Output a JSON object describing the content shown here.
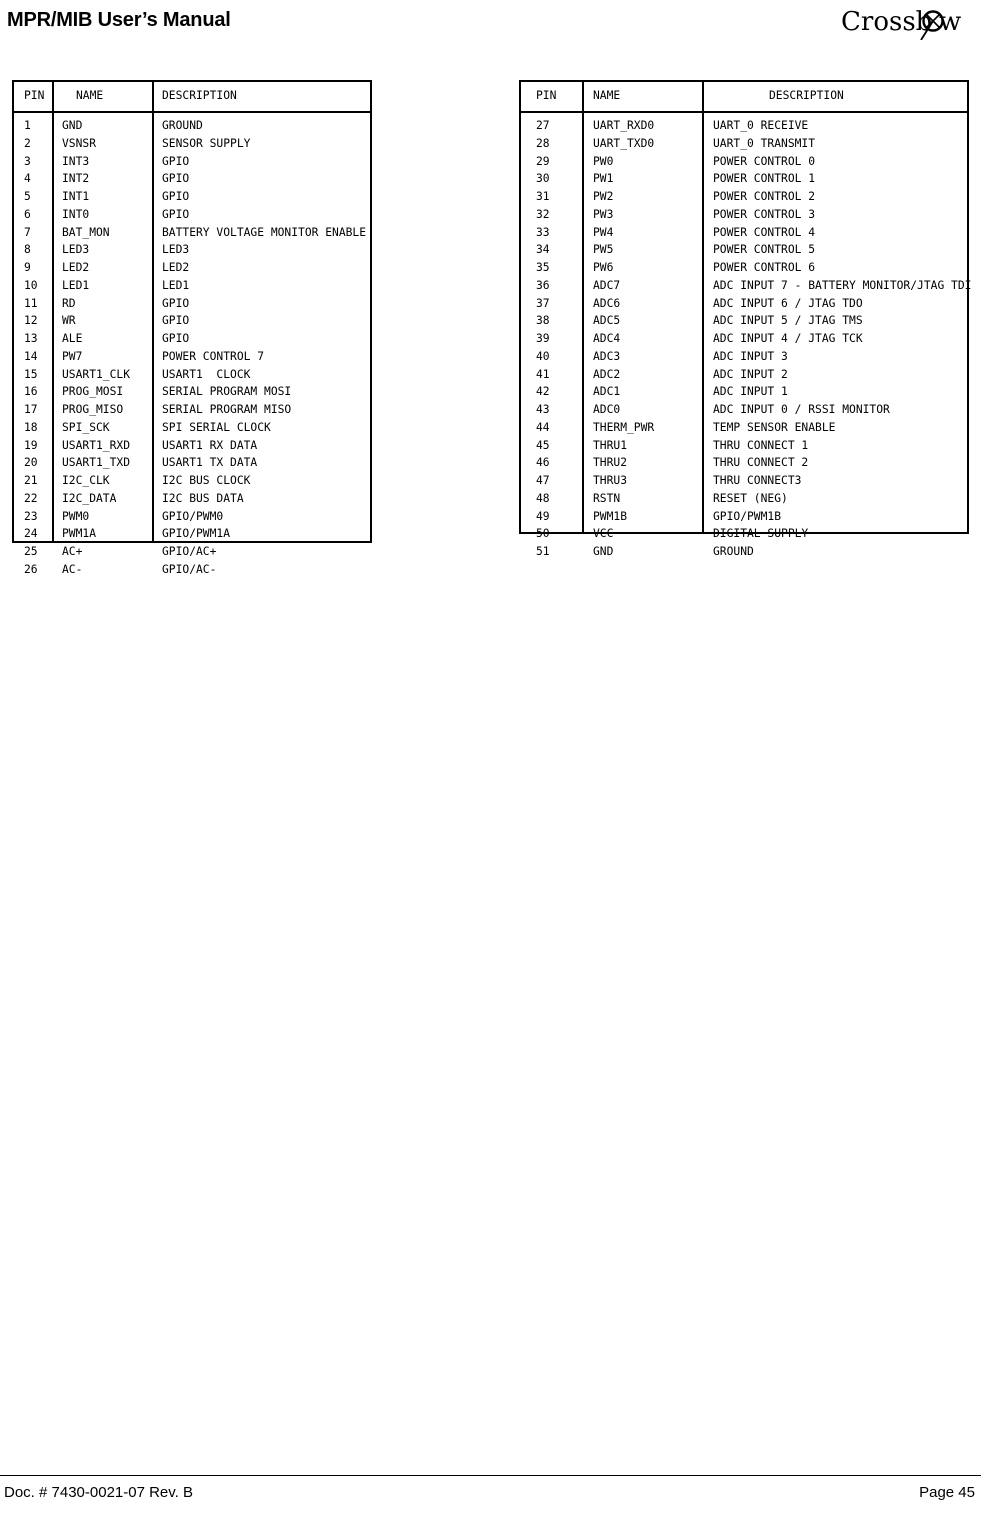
{
  "header": {
    "title": "MPR/MIB User’s Manual",
    "logo_text": "Crossb",
    "logo_text_tail": "w",
    "logo_name": "crossbow-logo"
  },
  "footer": {
    "doc_number": "Doc. # 7430-0021-07 Rev. B",
    "page_number": "Page 45"
  },
  "tables": {
    "left": {
      "columns": [
        "PIN",
        "NAME",
        "DESCRIPTION"
      ],
      "rows": [
        [
          "1",
          "GND",
          "GROUND"
        ],
        [
          "2",
          "VSNSR",
          "SENSOR SUPPLY"
        ],
        [
          "3",
          "INT3",
          "GPIO"
        ],
        [
          "4",
          "INT2",
          "GPIO"
        ],
        [
          "5",
          "INT1",
          "GPIO"
        ],
        [
          "6",
          "INT0",
          "GPIO"
        ],
        [
          "7",
          "BAT_MON",
          "BATTERY VOLTAGE MONITOR ENABLE"
        ],
        [
          "8",
          "LED3",
          "LED3"
        ],
        [
          "9",
          "LED2",
          "LED2"
        ],
        [
          "10",
          "LED1",
          "LED1"
        ],
        [
          "11",
          "RD",
          "GPIO"
        ],
        [
          "12",
          "WR",
          "GPIO"
        ],
        [
          "13",
          "ALE",
          "GPIO"
        ],
        [
          "14",
          "PW7",
          "POWER CONTROL 7"
        ],
        [
          "15",
          "USART1_CLK",
          "USART1  CLOCK"
        ],
        [
          "16",
          "PROG_MOSI",
          "SERIAL PROGRAM MOSI"
        ],
        [
          "17",
          "PROG_MISO",
          "SERIAL PROGRAM MISO"
        ],
        [
          "18",
          "SPI_SCK",
          "SPI SERIAL CLOCK"
        ],
        [
          "19",
          "USART1_RXD",
          "USART1 RX DATA"
        ],
        [
          "20",
          "USART1_TXD",
          "USART1 TX DATA"
        ],
        [
          "21",
          "I2C_CLK",
          "I2C BUS CLOCK"
        ],
        [
          "22",
          "I2C_DATA",
          "I2C BUS DATA"
        ],
        [
          "23",
          "PWM0",
          "GPIO/PWM0"
        ],
        [
          "24",
          "PWM1A",
          "GPIO/PWM1A"
        ],
        [
          "25",
          "AC+",
          "GPIO/AC+"
        ],
        [
          "26",
          "AC-",
          "GPIO/AC-"
        ]
      ]
    },
    "right": {
      "columns": [
        "PIN",
        "NAME",
        "DESCRIPTION"
      ],
      "rows": [
        [
          "27",
          "UART_RXD0",
          "UART_0 RECEIVE"
        ],
        [
          "28",
          "UART_TXD0",
          "UART_0 TRANSMIT"
        ],
        [
          "29",
          "PW0",
          "POWER CONTROL 0"
        ],
        [
          "30",
          "PW1",
          "POWER CONTROL 1"
        ],
        [
          "31",
          "PW2",
          "POWER CONTROL 2"
        ],
        [
          "32",
          "PW3",
          "POWER CONTROL 3"
        ],
        [
          "33",
          "PW4",
          "POWER CONTROL 4"
        ],
        [
          "34",
          "PW5",
          "POWER CONTROL 5"
        ],
        [
          "35",
          "PW6",
          "POWER CONTROL 6"
        ],
        [
          "36",
          "ADC7",
          "ADC INPUT 7 - BATTERY MONITOR/JTAG TDI"
        ],
        [
          "37",
          "ADC6",
          "ADC INPUT 6 / JTAG TDO"
        ],
        [
          "38",
          "ADC5",
          "ADC INPUT 5 / JTAG TMS"
        ],
        [
          "39",
          "ADC4",
          "ADC INPUT 4 / JTAG TCK"
        ],
        [
          "40",
          "ADC3",
          "ADC INPUT 3"
        ],
        [
          "41",
          "ADC2",
          "ADC INPUT 2"
        ],
        [
          "42",
          "ADC1",
          "ADC INPUT 1"
        ],
        [
          "43",
          "ADC0",
          "ADC INPUT 0 / RSSI MONITOR"
        ],
        [
          "44",
          "THERM_PWR",
          "TEMP SENSOR ENABLE"
        ],
        [
          "45",
          "THRU1",
          "THRU CONNECT 1"
        ],
        [
          "46",
          "THRU2",
          "THRU CONNECT 2"
        ],
        [
          "47",
          "THRU3",
          "THRU CONNECT3"
        ],
        [
          "48",
          "RSTN",
          "RESET (NEG)"
        ],
        [
          "49",
          "PWM1B",
          "GPIO/PWM1B"
        ],
        [
          "50",
          "VCC",
          "DIGITAL SUPPLY"
        ],
        [
          "51",
          "GND",
          "GROUND"
        ]
      ]
    }
  }
}
